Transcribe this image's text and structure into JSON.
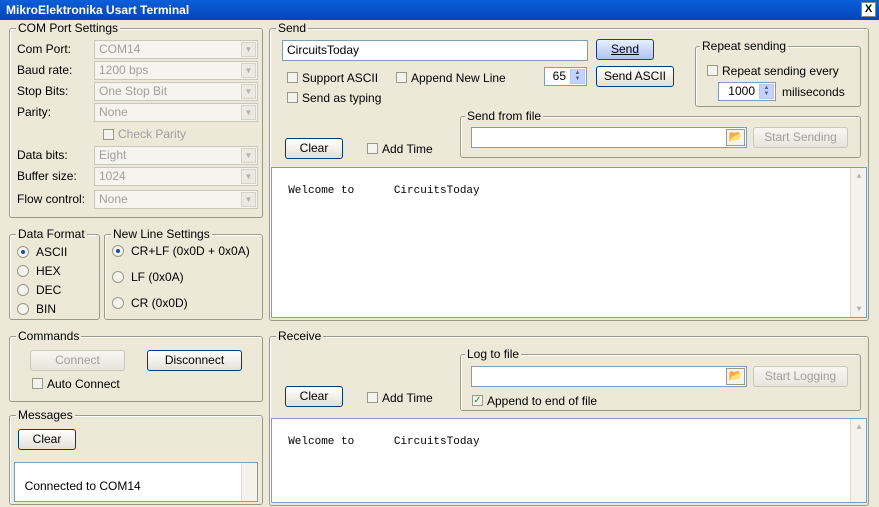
{
  "window": {
    "title": "MikroElektronika Usart Terminal",
    "close_glyph": "X"
  },
  "com_port": {
    "legend": "COM Port Settings",
    "rows": [
      {
        "label": "Com Port:",
        "value": "COM14"
      },
      {
        "label": "Baud rate:",
        "value": "1200 bps"
      },
      {
        "label": "Stop Bits:",
        "value": "One Stop Bit"
      },
      {
        "label": "Parity:",
        "value": "None"
      },
      {
        "label": "Data bits:",
        "value": "Eight"
      },
      {
        "label": "Buffer size:",
        "value": "1024"
      },
      {
        "label": "Flow control:",
        "value": "None"
      }
    ],
    "check_parity": "Check Parity"
  },
  "data_format": {
    "legend": "Data Format",
    "options": [
      "ASCII",
      "HEX",
      "DEC",
      "BIN"
    ],
    "selected": "ASCII"
  },
  "new_line": {
    "legend": "New Line Settings",
    "options": [
      "CR+LF (0x0D + 0x0A)",
      "LF (0x0A)",
      "CR (0x0D)"
    ],
    "selected": "CR+LF (0x0D + 0x0A)"
  },
  "commands": {
    "legend": "Commands",
    "connect": "Connect",
    "disconnect": "Disconnect",
    "auto_connect": "Auto Connect"
  },
  "messages": {
    "legend": "Messages",
    "clear": "Clear",
    "log": "Connected to COM14"
  },
  "send": {
    "legend": "Send",
    "input_value": "CircuitsToday",
    "send_button": "Send",
    "support_ascii": "Support ASCII",
    "append_new_line": "Append New Line",
    "ascii_value": "65",
    "send_ascii_button": "Send ASCII",
    "send_as_typing": "Send as typing",
    "repeat_legend": "Repeat sending",
    "repeat_every": "Repeat sending every",
    "repeat_ms": "1000",
    "miliseconds": "miliseconds",
    "file_legend": "Send from file",
    "start_sending": "Start Sending",
    "clear": "Clear",
    "add_time": "Add Time",
    "output": "Welcome to      CircuitsToday"
  },
  "receive": {
    "legend": "Receive",
    "log_legend": "Log to file",
    "start_logging": "Start Logging",
    "append_end": "Append to end of file",
    "clear": "Clear",
    "add_time": "Add Time",
    "output": "Welcome to      CircuitsToday"
  }
}
